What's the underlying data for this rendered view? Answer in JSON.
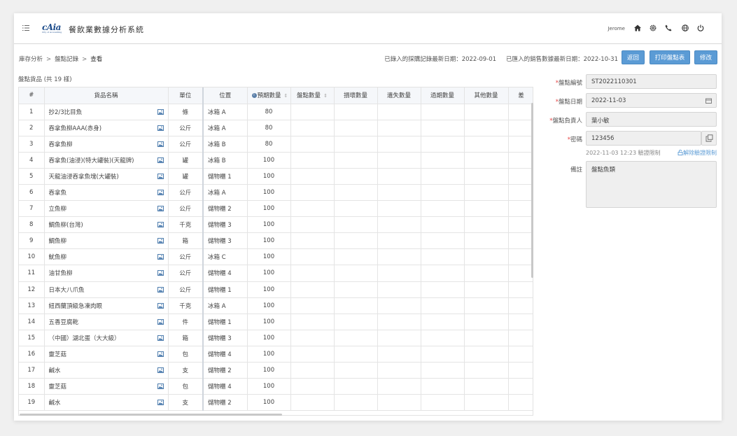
{
  "header": {
    "logo_text": "cAia",
    "logo_sub": "City of Accounting",
    "title": "餐飲業數據分析系統",
    "user": "Jerome"
  },
  "breadcrumb": [
    "庫存分析",
    "盤點記錄",
    "查看"
  ],
  "dates": {
    "purchase": "已錄入的採購記錄最新日期：2022-09-01",
    "sales": "已匯入的銷售數據最新日期：2022-10-31"
  },
  "buttons": {
    "back": "返回",
    "print": "打印盤點表",
    "edit": "修改"
  },
  "list_title": "盤點貨品 (共 19 樣)",
  "table": {
    "columns": [
      "#",
      "貨品名稱",
      "單位",
      "位置",
      "預期數量",
      "盤點數量",
      "損壞數量",
      "遺失數量",
      "過期數量",
      "其他數量",
      "差"
    ],
    "rows": [
      [
        "1",
        "抄2/3比目魚",
        "條",
        "冰箱 A",
        "80"
      ],
      [
        "2",
        "吞拿魚柳AAA(赤身)",
        "公斤",
        "冰箱 A",
        "80"
      ],
      [
        "3",
        "吞拿魚柳",
        "公斤",
        "冰箱 B",
        "80"
      ],
      [
        "4",
        "吞拿魚(油浸)(特大罐裝)(天龍牌)",
        "罐",
        "冰箱 B",
        "100"
      ],
      [
        "5",
        "天龍油浸吞拿魚塊(大罐裝)",
        "罐",
        "儲物櫃 1",
        "100"
      ],
      [
        "6",
        "吞拿魚",
        "公斤",
        "冰箱 A",
        "100"
      ],
      [
        "7",
        "立魚柳",
        "公斤",
        "儲物櫃 2",
        "100"
      ],
      [
        "8",
        "鯛魚柳(台灣)",
        "千克",
        "儲物櫃 3",
        "100"
      ],
      [
        "9",
        "鯛魚柳",
        "箱",
        "儲物櫃 3",
        "100"
      ],
      [
        "10",
        "魷魚柳",
        "公斤",
        "冰箱 C",
        "100"
      ],
      [
        "11",
        "油甘魚柳",
        "公斤",
        "儲物櫃 4",
        "100"
      ],
      [
        "12",
        "日本大八爪魚",
        "公斤",
        "儲物櫃 1",
        "100"
      ],
      [
        "13",
        "紐西蘭頂級急凍肉眼",
        "千克",
        "冰箱 A",
        "100"
      ],
      [
        "14",
        "五香豆腐乾",
        "件",
        "儲物櫃 1",
        "100"
      ],
      [
        "15",
        "（中國）湖北蛋（大大級）",
        "箱",
        "儲物櫃 3",
        "100"
      ],
      [
        "16",
        "靈芝菇",
        "包",
        "儲物櫃 4",
        "100"
      ],
      [
        "17",
        "鹹水",
        "支",
        "儲物櫃 2",
        "100"
      ],
      [
        "18",
        "靈芝菇",
        "包",
        "儲物櫃 4",
        "100"
      ],
      [
        "19",
        "鹹水",
        "支",
        "儲物櫃 2",
        "100"
      ]
    ]
  },
  "form": {
    "code_label": "盤點編號",
    "code_value": "ST2022110301",
    "date_label": "盤點日期",
    "date_value": "2022-11-03",
    "person_label": "盤點負責人",
    "person_value": "葉小敏",
    "password_label": "密碼",
    "password_value": "123456",
    "hint": "2022-11-03 12:23 驗證限制",
    "unlock": "解除驗證限制",
    "remark_label": "備註",
    "remark_value": "盤點魚類"
  }
}
